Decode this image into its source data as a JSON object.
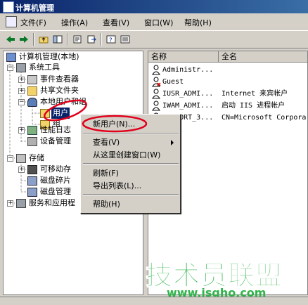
{
  "window": {
    "title": "计算机管理"
  },
  "menubar": {
    "items": [
      "文件(F)",
      "操作(A)",
      "查看(V)",
      "窗口(W)",
      "帮助(H)"
    ]
  },
  "toolbar": {
    "buttons": [
      "back-icon",
      "forward-icon",
      "up-folder-icon",
      "show-hide-tree-icon",
      "properties-icon",
      "export-icon",
      "help-icon",
      "details-view-icon"
    ]
  },
  "tree": {
    "root": "计算机管理(本地)",
    "system_tools": "系统工具",
    "event_viewer": "事件查看器",
    "shared_folders": "共享文件夹",
    "local_users_groups": "本地用户和组",
    "users": "用户",
    "groups": "组",
    "perf_logs": "性能日志",
    "device_manager": "设备管理",
    "storage": "存储",
    "removable_storage": "可移动存",
    "disk_defrag": "磁盘碎片",
    "disk_mgmt": "磁盘管理",
    "services_apps": "服务和应用程"
  },
  "list": {
    "columns": [
      "名称",
      "全名"
    ],
    "rows": [
      {
        "name": "Administr...",
        "fullname": ""
      },
      {
        "name": "Guest",
        "fullname": ""
      },
      {
        "name": "IUSR_ADMI...",
        "fullname": "Internet 来宾帐户"
      },
      {
        "name": "IWAM_ADMI...",
        "fullname": "启动 IIS 进程帐户"
      },
      {
        "name": "SUPPORT_3...",
        "fullname": "CN=Microsoft Corpora..."
      }
    ]
  },
  "context_menu": {
    "new_user": "新用户(N)...",
    "view": "查看(V)",
    "new_window": "从这里创建窗口(W)",
    "refresh": "刷新(F)",
    "export": "导出列表(L)...",
    "help": "帮助(H)"
  },
  "watermark": {
    "line1": "技术员联盟",
    "line2": "www.jsgho.com"
  },
  "colors": {
    "title_start": "#0a246a",
    "title_end": "#3a6ea5",
    "annotation_red": "#e0001b",
    "watermark_green": "#2fb44a"
  }
}
